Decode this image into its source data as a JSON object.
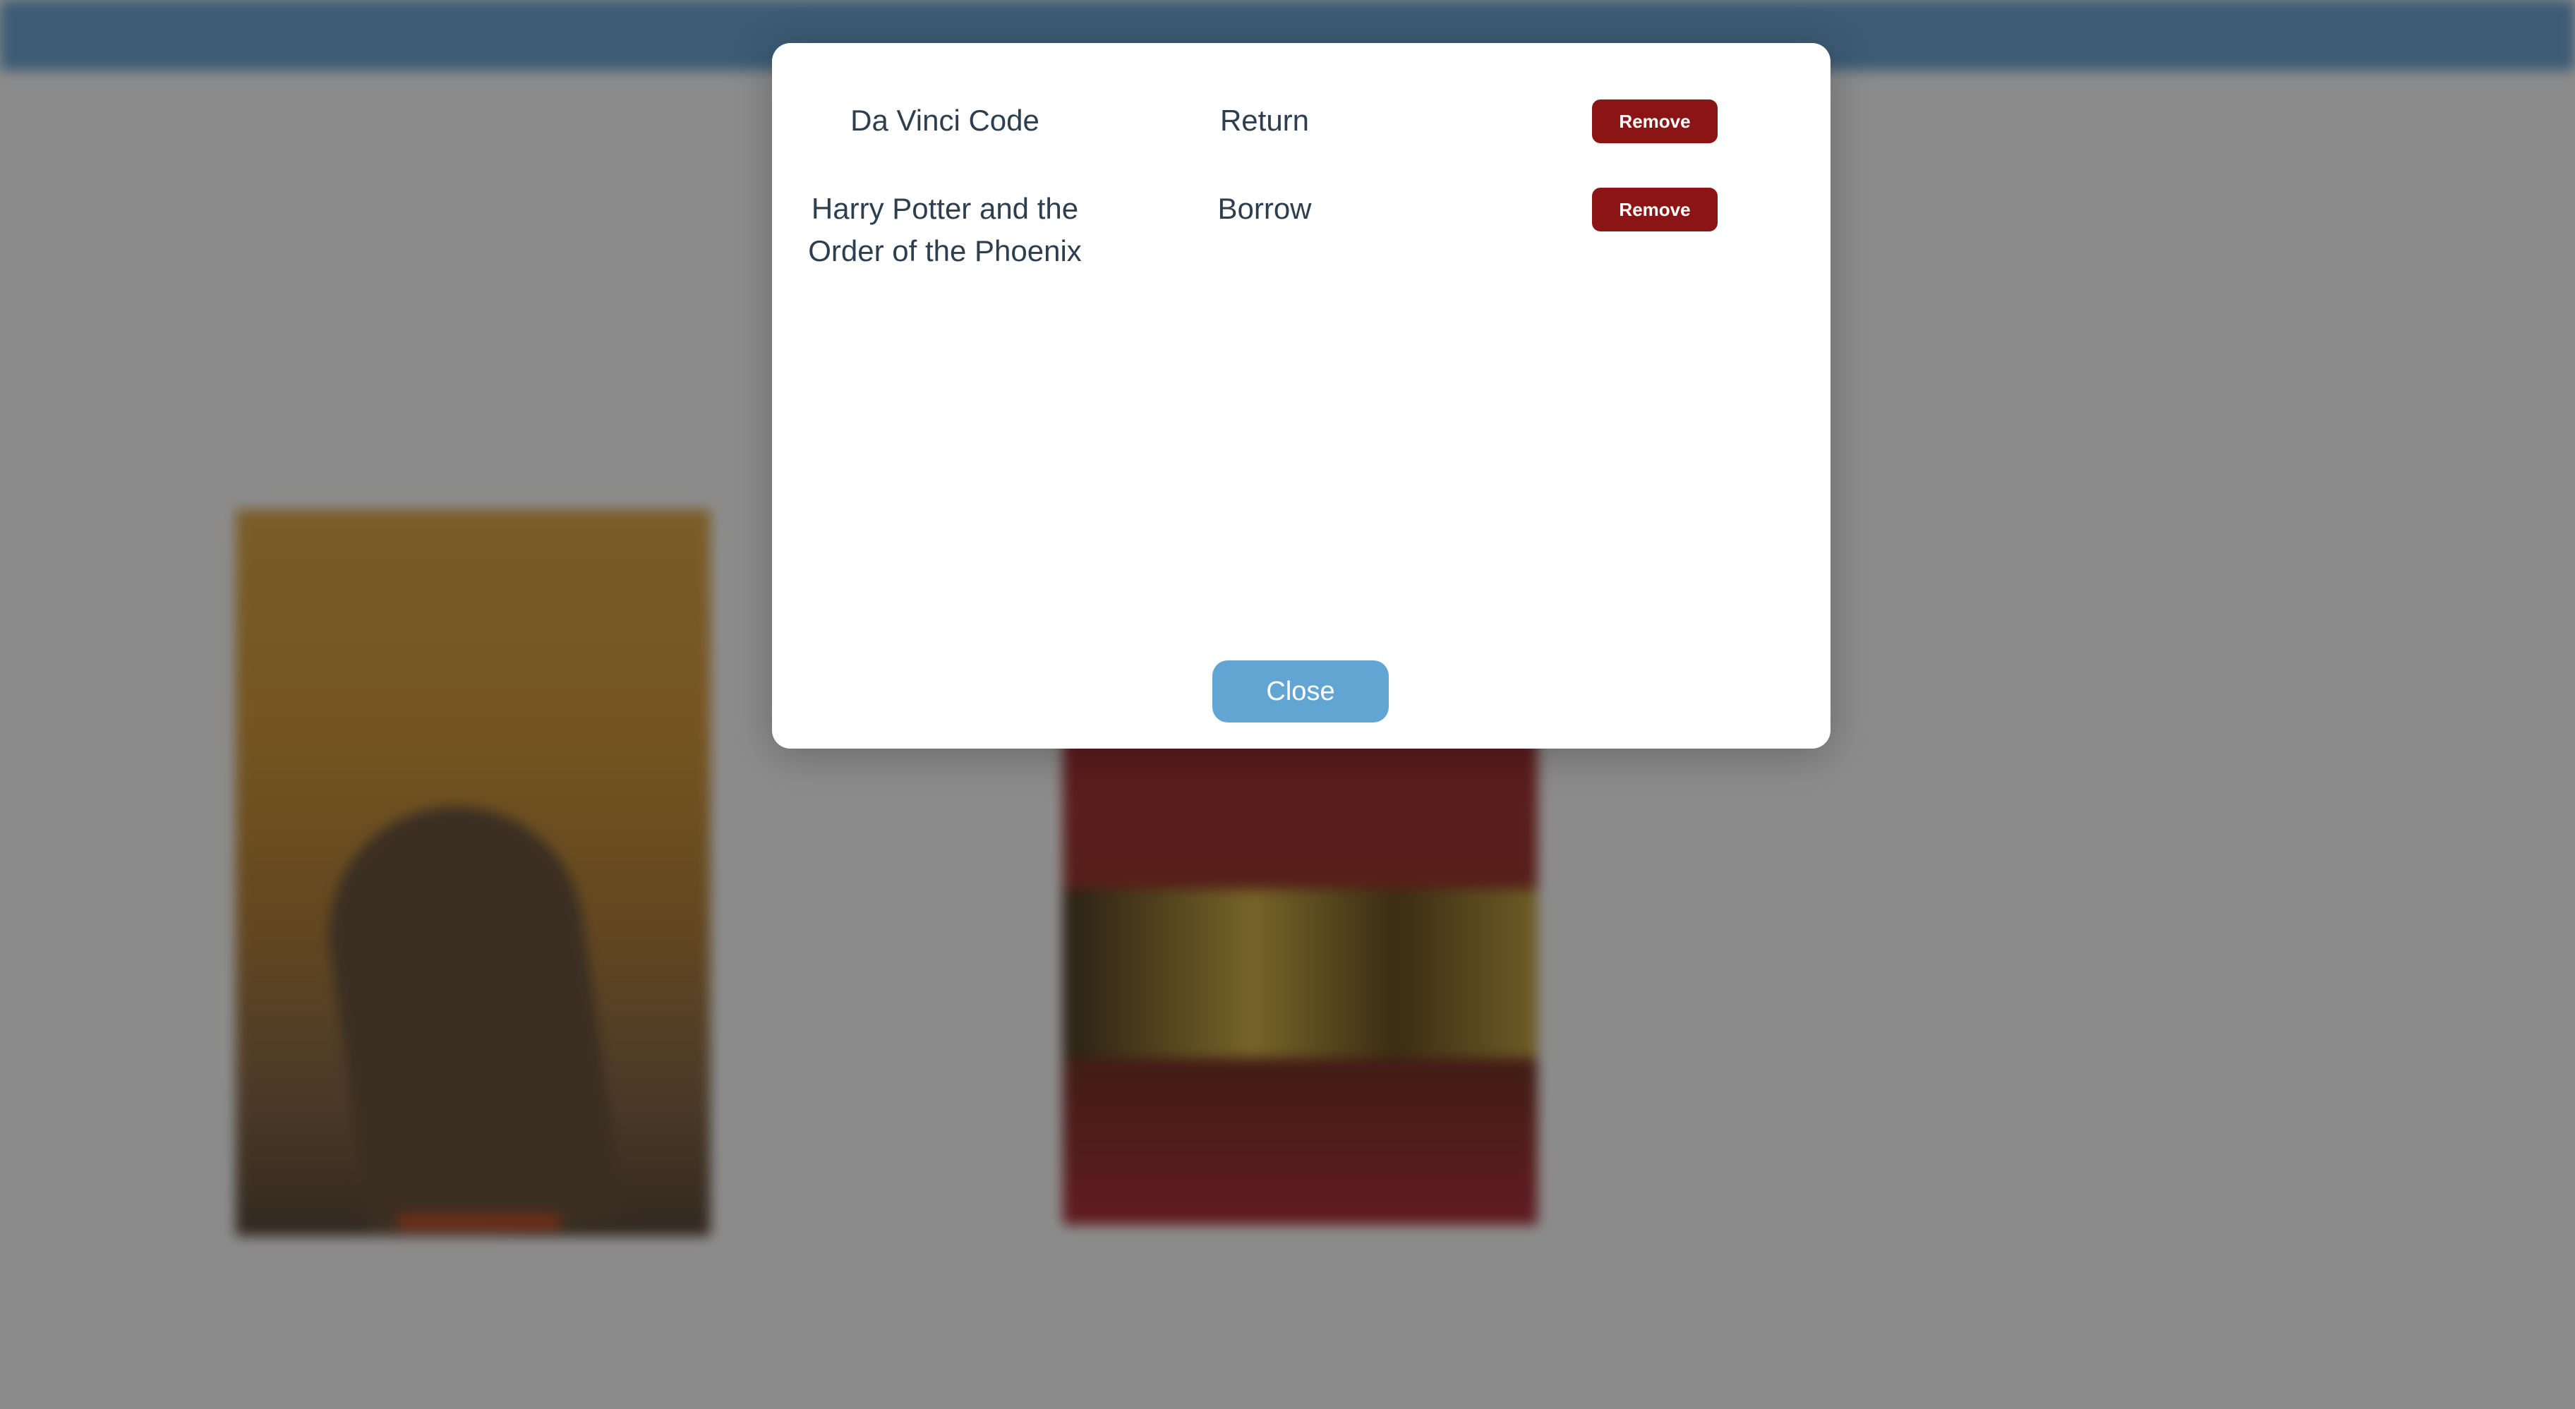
{
  "modal": {
    "rows": [
      {
        "title": "Da Vinci Code",
        "action": "Return",
        "remove_label": "Remove"
      },
      {
        "title": "Harry Potter and the Order of the Phoenix",
        "action": "Borrow",
        "remove_label": "Remove"
      }
    ],
    "close_label": "Close"
  },
  "colors": {
    "remove_button": "#8b1414",
    "close_button": "#62a5d2",
    "navbar": "#6fa6d6",
    "overlay": "rgba(0,0,0,0.45)"
  }
}
